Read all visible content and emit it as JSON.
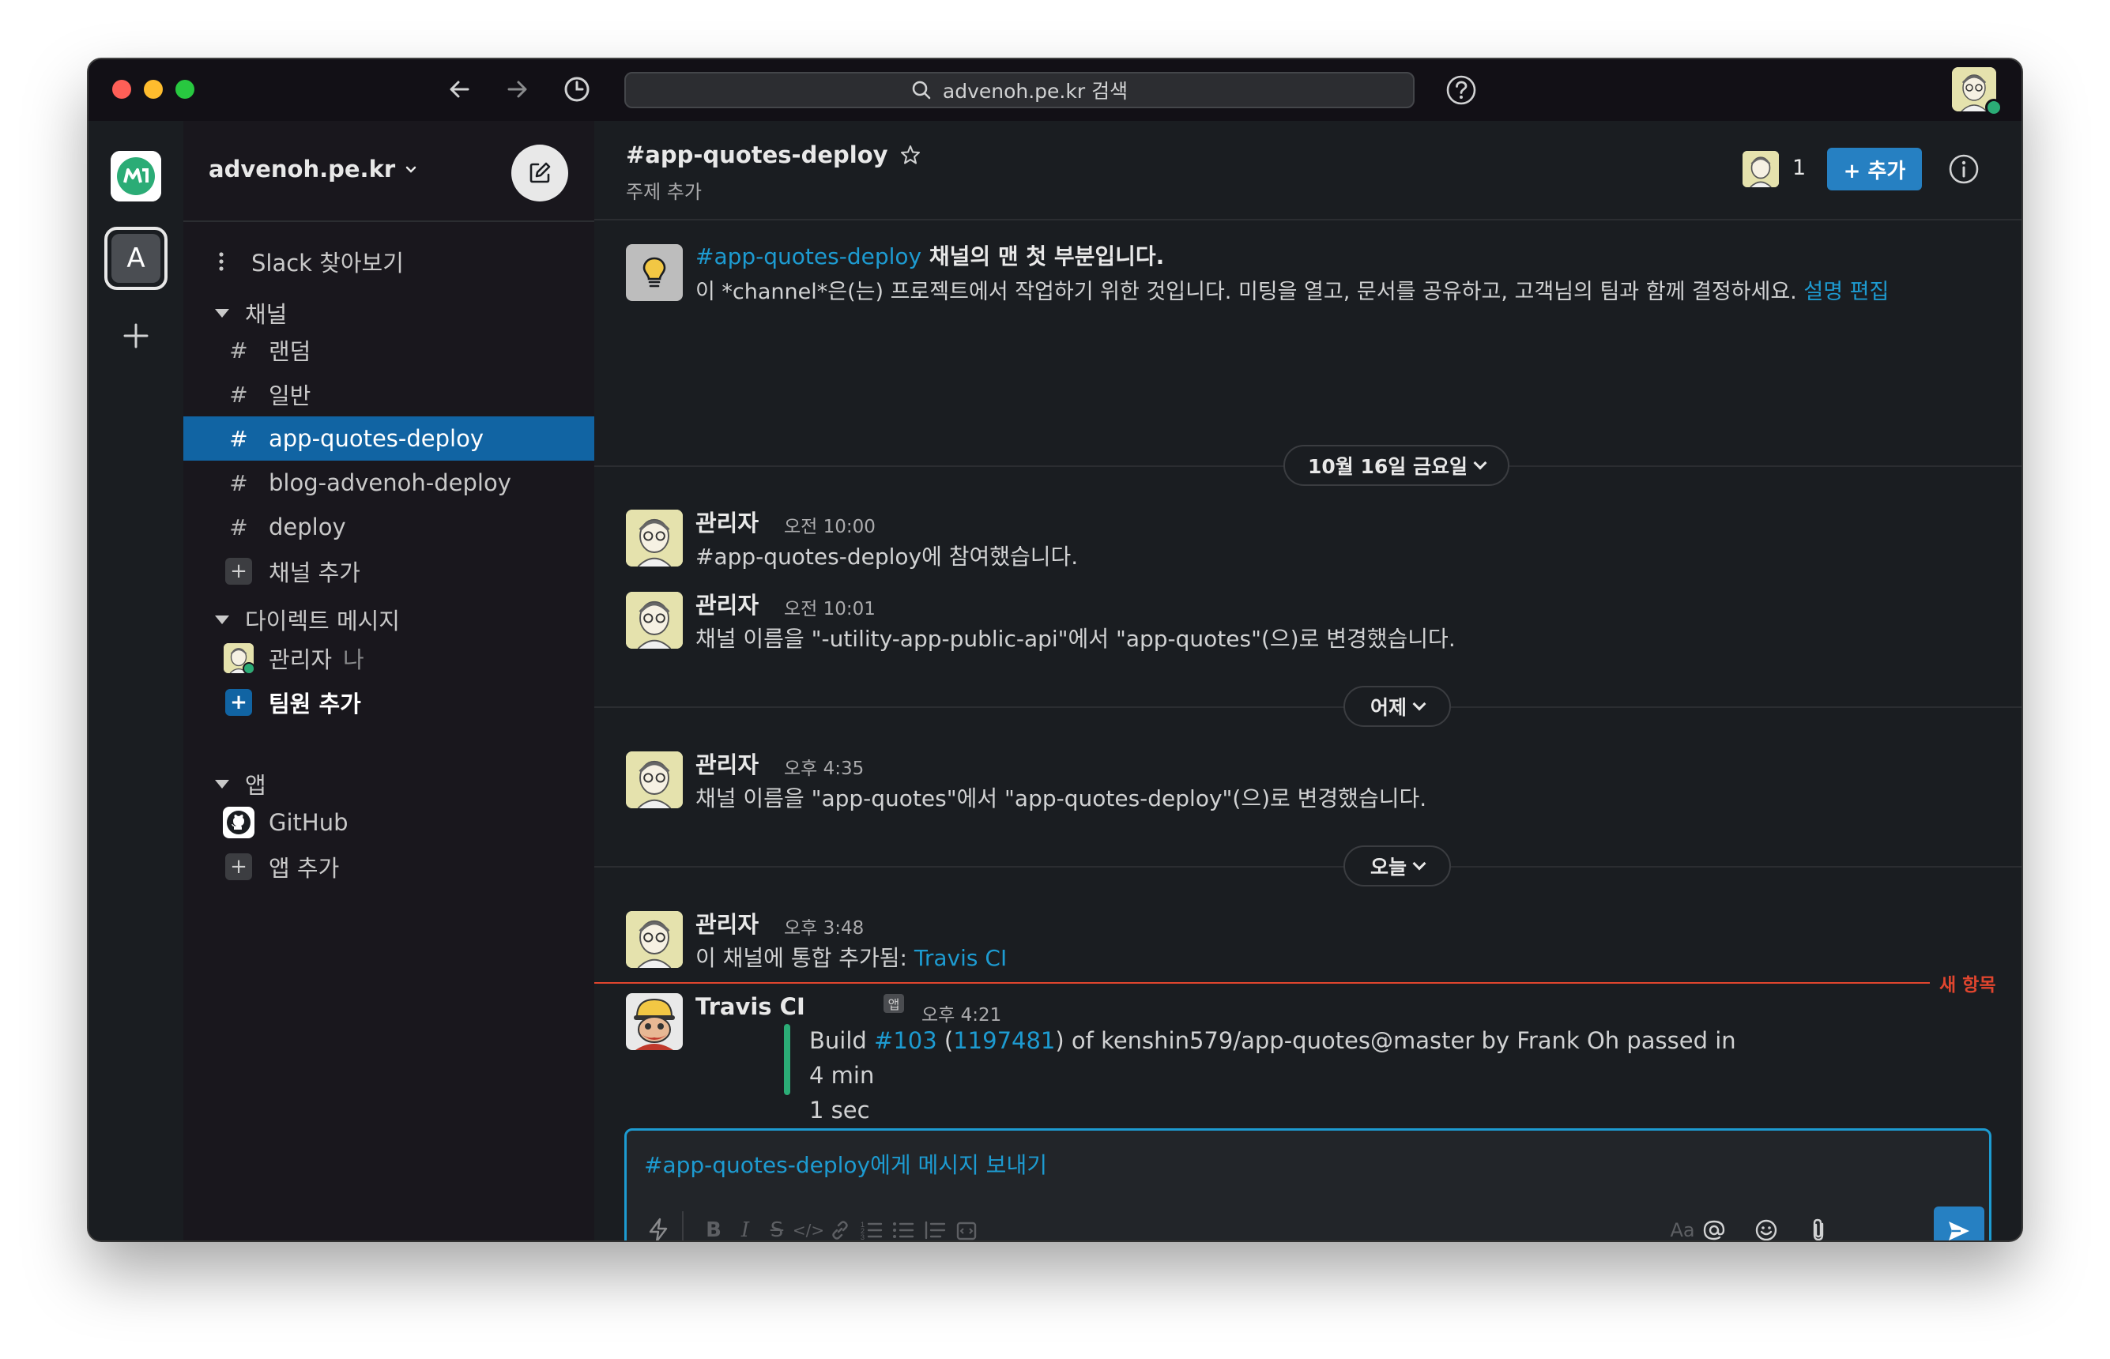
{
  "colors": {
    "accent": "#1d9bd1",
    "active_channel": "#1164a3",
    "add_button": "#2680c2",
    "presence": "#2bac76",
    "new_items": "#e0452e"
  },
  "titlebar": {
    "search_text": "advenoh.pe.kr 검색",
    "icons": [
      "back-arrow-icon",
      "forward-arrow-icon",
      "history-icon",
      "search-icon",
      "help-icon"
    ]
  },
  "rail": {
    "workspace_letter": "A"
  },
  "sidebar": {
    "workspace_name": "advenoh.pe.kr",
    "browse_label": "Slack 찾아보기",
    "channels_header": "채널",
    "channels": [
      {
        "name": "랜덤",
        "active": false
      },
      {
        "name": "일반",
        "active": false
      },
      {
        "name": "app-quotes-deploy",
        "active": true
      },
      {
        "name": "blog-advenoh-deploy",
        "active": false
      },
      {
        "name": "deploy",
        "active": false
      }
    ],
    "add_channel_label": "채널 추가",
    "dm_header": "다이렉트 메시지",
    "dm_self_name": "관리자",
    "dm_self_suffix": "나",
    "add_member_label": "팀원 추가",
    "apps_header": "앱",
    "github_label": "GitHub",
    "add_app_label": "앱 추가"
  },
  "channel_header": {
    "title": "#app-quotes-deploy",
    "topic": "주제 추가",
    "member_count": "1",
    "add_button_label": "+ 추가"
  },
  "intro": {
    "channel_link": "#app-quotes-deploy",
    "title_suffix": " 채널의 맨 첫 부분입니다.",
    "description": "이 *channel*은(는) 프로젝트에서 작업하기 위한 것입니다. 미팅을 열고, 문서를 공유하고, 고객님의 팀과 함께 결정하세요. ",
    "edit_link": "설명 편집"
  },
  "day_dividers": [
    "10월 16일 금요일",
    "어제",
    "오늘"
  ],
  "messages": [
    {
      "author": "관리자",
      "time": "오전 10:00",
      "text": "#app-quotes-deploy에 참여했습니다."
    },
    {
      "author": "관리자",
      "time": "오전 10:01",
      "text": "채널 이름을 \"-utility-app-public-api\"에서 \"app-quotes\"(으)로 변경했습니다."
    },
    {
      "author": "관리자",
      "time": "오후 4:35",
      "text": "채널 이름을 \"app-quotes\"에서 \"app-quotes-deploy\"(으)로 변경했습니다."
    },
    {
      "author": "관리자",
      "time": "오후 3:48",
      "text_prefix": "이 채널에 통합 추가됨: ",
      "link": "Travis CI"
    }
  ],
  "new_items_label": "새 항목",
  "travis_message": {
    "author": "Travis CI",
    "app_badge": "앱",
    "time": "오후 4:21",
    "build_prefix": "Build ",
    "build_number": "#103",
    "open_paren": " (",
    "commit": "1197481",
    "build_suffix": ") of kenshin579/app-quotes@master by Frank Oh passed in 4 min",
    "build_suffix2": "1 sec"
  },
  "composer": {
    "placeholder_channel": "#app-quotes-deploy",
    "placeholder_suffix": "에게 메시지 보내기",
    "aa_label": "Aa",
    "toolbar_icons": [
      "shortcuts-icon",
      "bold-icon",
      "italic-icon",
      "strikethrough-icon",
      "code-icon",
      "link-icon",
      "ordered-list-icon",
      "bulleted-list-icon",
      "blockquote-icon",
      "code-block-icon",
      "format-icon",
      "mention-icon",
      "emoji-icon",
      "attachment-icon",
      "send-icon"
    ]
  }
}
